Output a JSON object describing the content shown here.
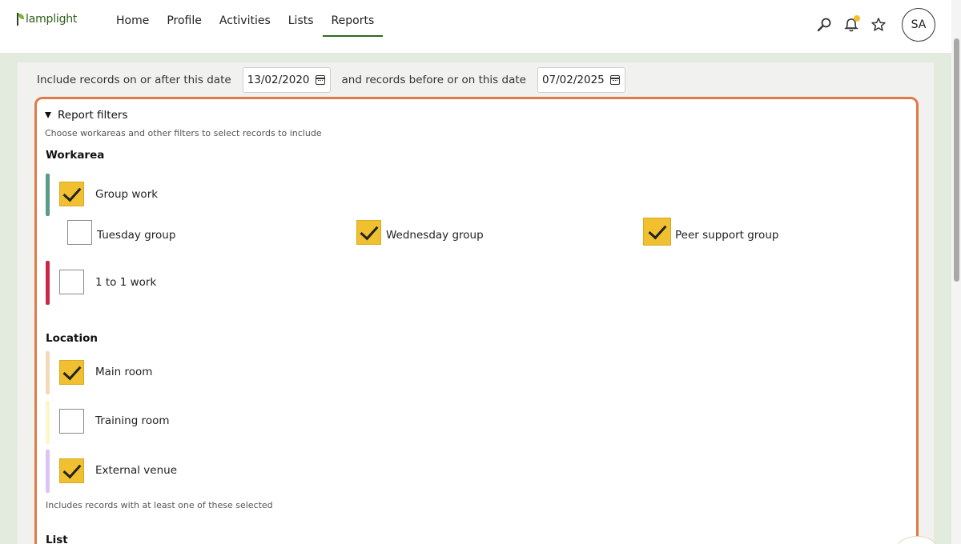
{
  "app": {
    "logo_text": "lamplight"
  },
  "nav": {
    "items": [
      {
        "label": "Home"
      },
      {
        "label": "Profile"
      },
      {
        "label": "Activities"
      },
      {
        "label": "Lists"
      },
      {
        "label": "Reports"
      }
    ],
    "active": "Reports"
  },
  "header": {
    "avatar_initials": "SA",
    "icons": [
      "search-icon",
      "bell-icon",
      "star-icon"
    ],
    "notification_dot_color": "#f0c030"
  },
  "dates": {
    "after_label": "Include records on or after this date",
    "after_value": "13/02/2020",
    "before_label": "and records before or on this date",
    "before_value": "07/02/2025"
  },
  "filters": {
    "summary": "Report filters",
    "hint": "Choose workareas and other filters to select records to include",
    "workarea": {
      "title": "Workarea",
      "group_work": {
        "label": "Group work",
        "checked": true,
        "accent": "#5a9a88"
      },
      "subgroups": [
        {
          "label": "Tuesday group",
          "checked": false
        },
        {
          "label": "Wednesday group",
          "checked": true
        },
        {
          "label": "Peer support group",
          "checked": true
        }
      ],
      "one_to_one": {
        "label": "1 to 1 work",
        "checked": false,
        "accent": "#c8284a"
      }
    },
    "location": {
      "title": "Location",
      "items": [
        {
          "label": "Main room",
          "checked": true,
          "accent": "#f4d9b8"
        },
        {
          "label": "Training room",
          "checked": false,
          "accent": "#fbf7c8"
        },
        {
          "label": "External venue",
          "checked": true,
          "accent": "#dcc4f4"
        }
      ],
      "hint": "Includes records with at least one of these selected"
    },
    "list_title": "List"
  },
  "colors": {
    "accent_orange": "#e07a47",
    "checkbox_yellow": "#f0c030",
    "nav_active": "#2e6b1e"
  }
}
